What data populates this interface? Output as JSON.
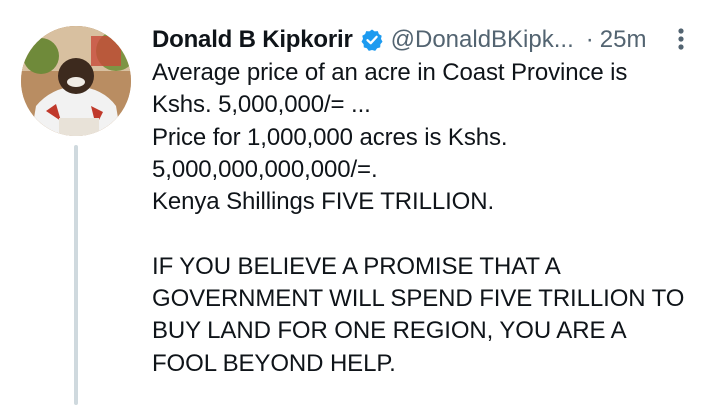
{
  "tweet": {
    "author_name": "Donald B Kipkorir",
    "handle": "@DonaldBKipk...",
    "separator": "·",
    "time": "25m",
    "lines": [
      "Average price of an acre in Coast Province is",
      "Kshs. 5,000,000/= ...",
      "Price for 1,000,000 acres is Kshs.",
      "5,000,000,000,000/=.",
      "Kenya Shillings FIVE TRILLION."
    ],
    "lines2": [
      "IF YOU BELIEVE A PROMISE THAT A",
      "GOVERNMENT WILL SPEND FIVE TRILLION TO",
      "BUY LAND FOR ONE REGION, YOU ARE A",
      "FOOL BEYOND HELP."
    ]
  },
  "icons": {
    "verified": "verified-badge-icon",
    "more": "more-vertical-icon"
  },
  "colors": {
    "text": "#0f1419",
    "secondary": "#536471",
    "verified": "#1d9bf0",
    "thread_line": "#cfd9de"
  }
}
